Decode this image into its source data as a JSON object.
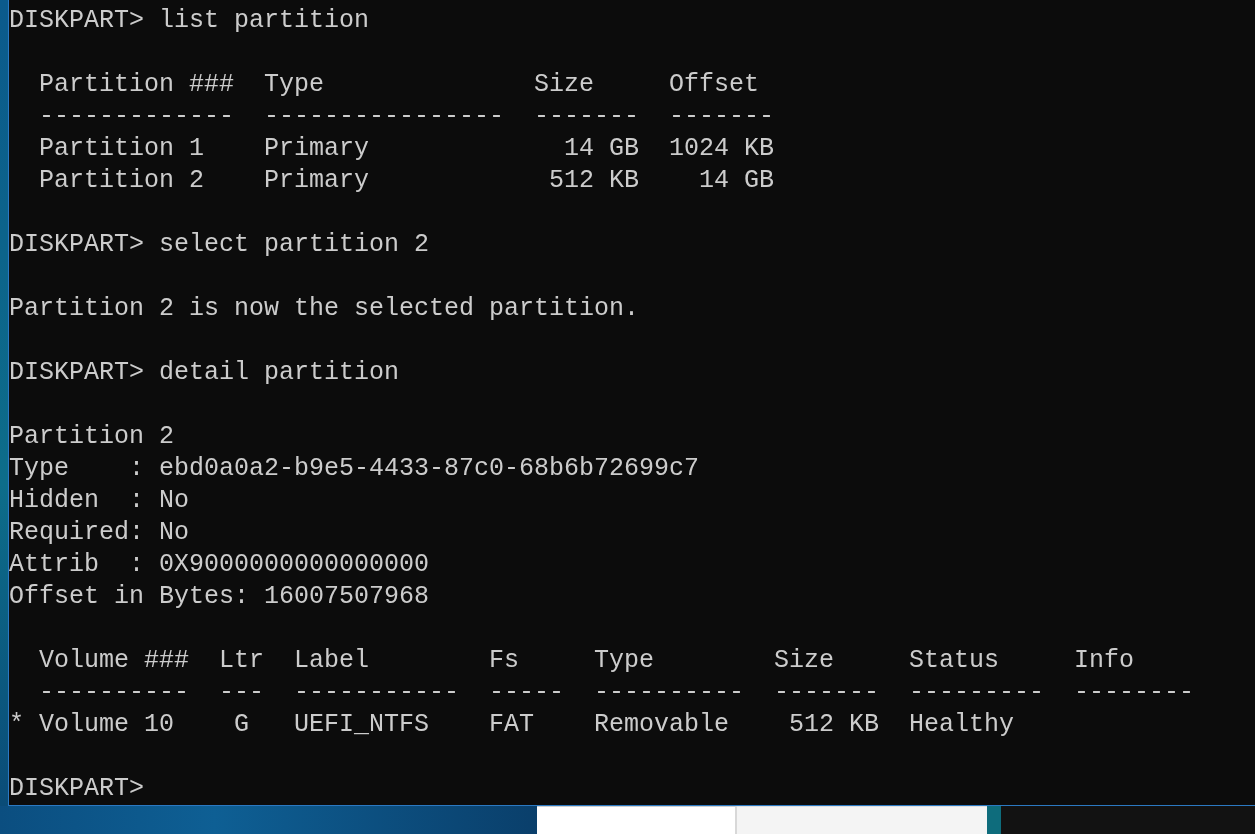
{
  "console": {
    "blocks": [
      {
        "kind": "command",
        "prompt": "DISKPART>",
        "command": "list partition"
      },
      {
        "kind": "table",
        "columns": [
          {
            "header": "Partition ###",
            "rule": "-------------",
            "kind": "text"
          },
          {
            "header": "Type",
            "rule": "----------------",
            "kind": "text"
          },
          {
            "header": "Size",
            "rule": "-------",
            "kind": "number"
          },
          {
            "header": "Offset",
            "rule": "-------",
            "kind": "number"
          }
        ],
        "rows": [
          {
            "cells": [
              "Partition 1",
              "Primary",
              "14 GB",
              "1024 KB"
            ]
          },
          {
            "cells": [
              "Partition 2",
              "Primary",
              "512 KB",
              "14 GB"
            ]
          }
        ]
      },
      {
        "kind": "command",
        "prompt": "DISKPART>",
        "command": "select partition 2"
      },
      {
        "kind": "message",
        "lines": [
          "Partition 2 is now the selected partition."
        ]
      },
      {
        "kind": "command",
        "prompt": "DISKPART>",
        "command": "detail partition"
      },
      {
        "kind": "message",
        "lines": [
          "Partition 2",
          "Type    : ebd0a0a2-b9e5-4433-87c0-68b6b72699c7",
          "Hidden  : No",
          "Required: No",
          "Attrib  : 0X9000000000000000",
          "Offset in Bytes: 16007507968"
        ]
      },
      {
        "kind": "table",
        "columns": [
          {
            "header": "Volume ###",
            "rule": "----------",
            "kind": "text"
          },
          {
            "header": "Ltr",
            "rule": "---",
            "kind": "letter"
          },
          {
            "header": "Label",
            "rule": "-----------",
            "kind": "text"
          },
          {
            "header": "Fs",
            "rule": "-----",
            "kind": "text"
          },
          {
            "header": "Type",
            "rule": "----------",
            "kind": "text"
          },
          {
            "header": "Size",
            "rule": "-------",
            "kind": "number"
          },
          {
            "header": "Status",
            "rule": "---------",
            "kind": "text"
          },
          {
            "header": "Info",
            "rule": "--------"
          }
        ],
        "rows": [
          {
            "marker": "*",
            "cells": [
              "Volume 10",
              "G",
              "UEFI_NTFS",
              "FAT",
              "Removable",
              "512 KB",
              "Healthy"
            ]
          }
        ]
      },
      {
        "kind": "command",
        "prompt": "DISKPART>"
      }
    ]
  }
}
